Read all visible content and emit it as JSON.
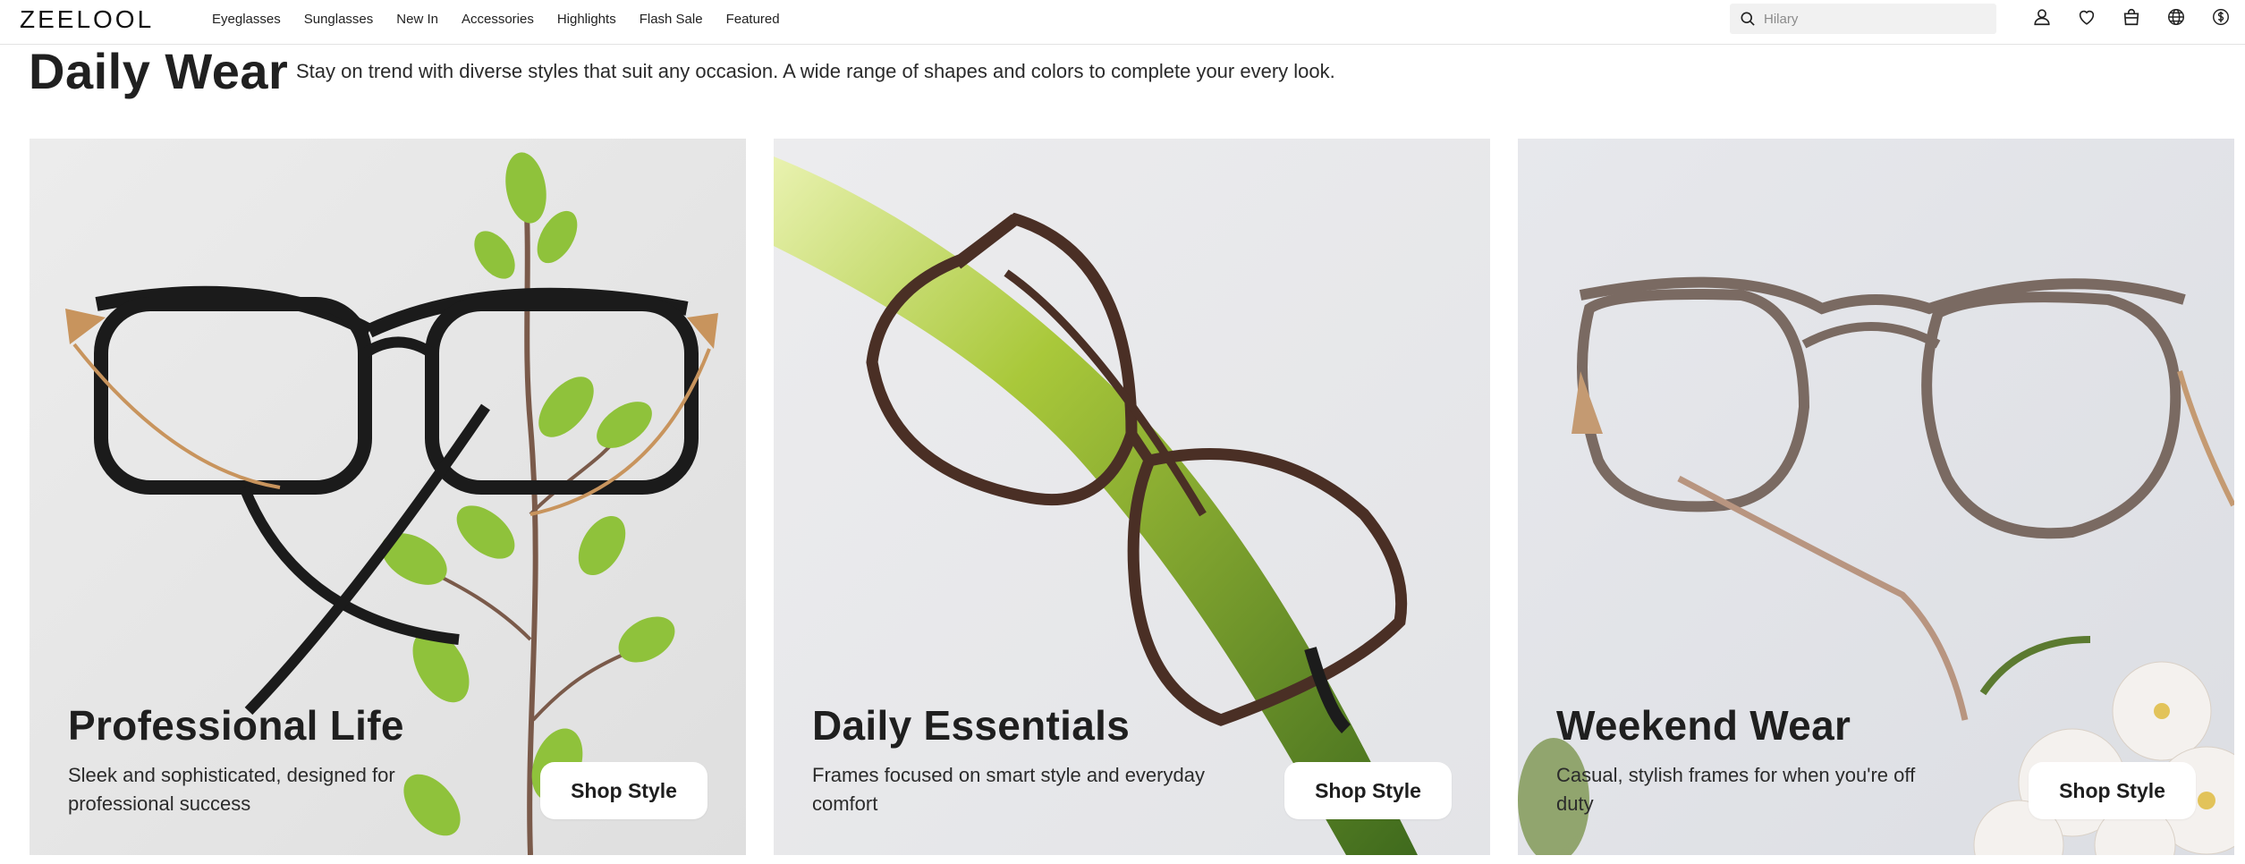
{
  "header": {
    "logo": "ZEELOOL",
    "nav": [
      {
        "label": "Eyeglasses"
      },
      {
        "label": "Sunglasses"
      },
      {
        "label": "New In"
      },
      {
        "label": "Accessories"
      },
      {
        "label": "Highlights"
      },
      {
        "label": "Flash Sale"
      },
      {
        "label": "Featured"
      }
    ],
    "search": {
      "placeholder": "Hilary",
      "icon": "search-icon"
    },
    "icons": [
      "account-icon",
      "heart-icon",
      "bag-icon",
      "globe-icon",
      "currency-icon"
    ]
  },
  "section": {
    "title": "Daily Wear",
    "subtitle": "Stay on trend with diverse styles that suit any occasion. A wide range of shapes and colors to complete your every look."
  },
  "cards": [
    {
      "title": "Professional Life",
      "description": "Sleek and sophisticated, designed for professional success",
      "button": "Shop Style"
    },
    {
      "title": "Daily Essentials",
      "description": "Frames focused on smart style and everyday comfort",
      "button": "Shop Style"
    },
    {
      "title": "Weekend Wear",
      "description": "Casual, stylish frames for when you're off duty",
      "button": "Shop Style"
    }
  ],
  "colors": {
    "text": "#1e1e1e",
    "card_bg_1": "#e6e6e6",
    "card_bg_2": "#e9eaec",
    "card_bg_3": "#e4e6ea",
    "button_bg": "#ffffff"
  }
}
